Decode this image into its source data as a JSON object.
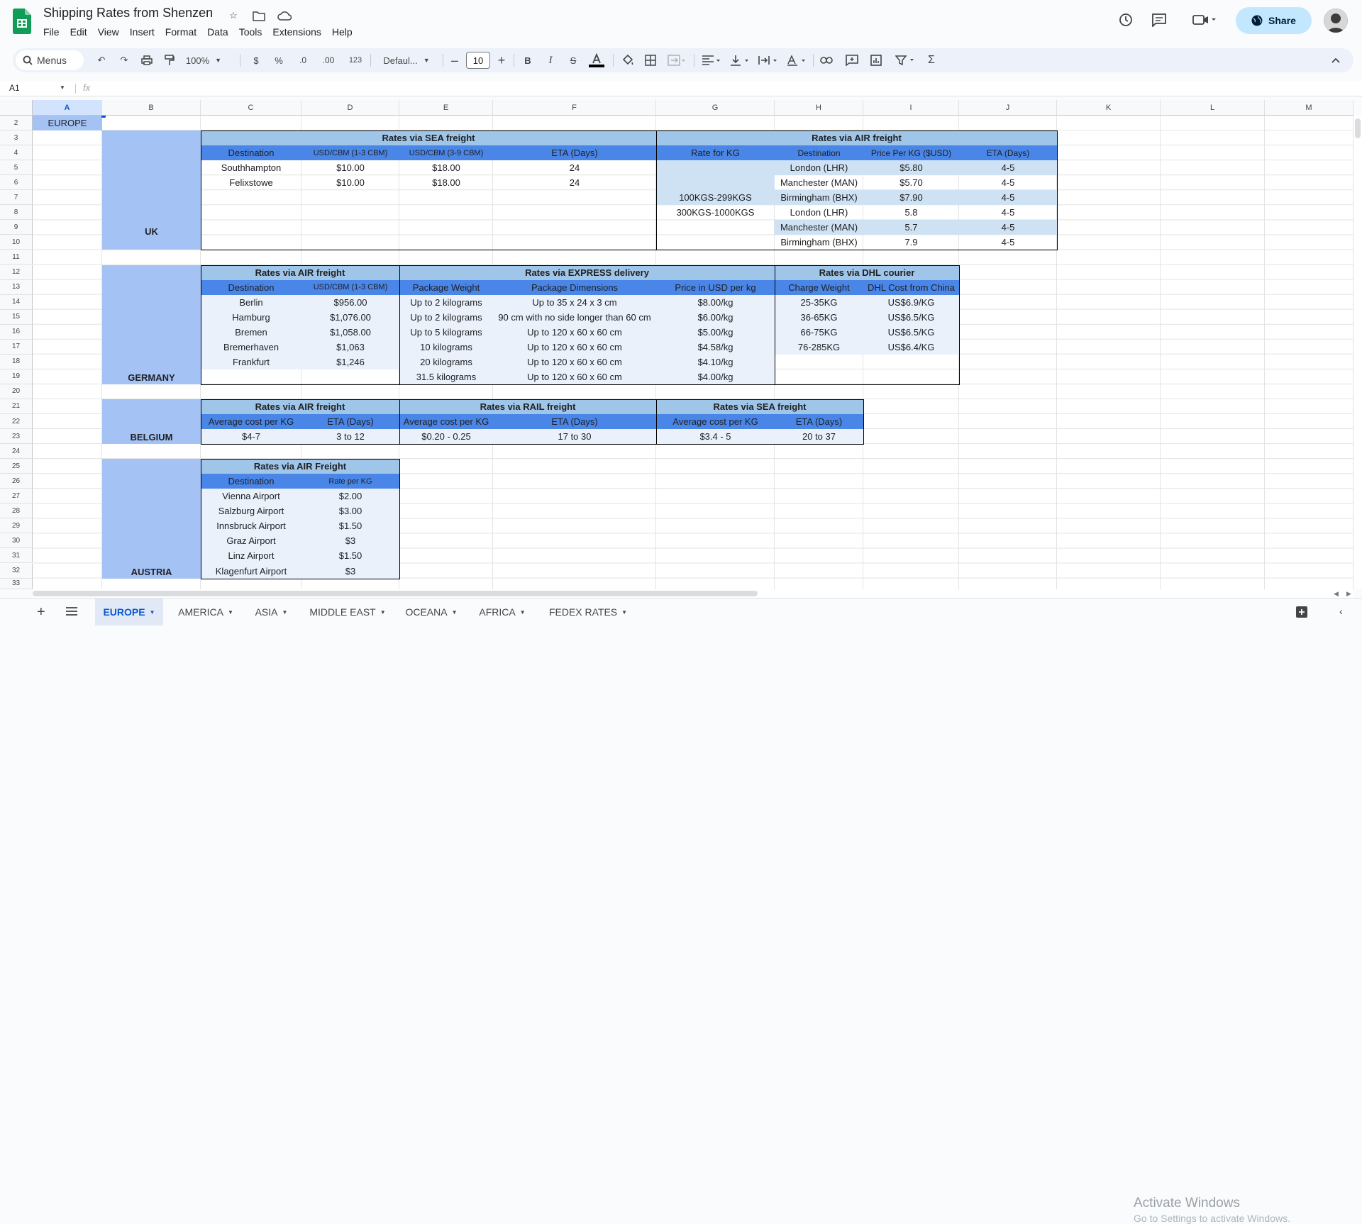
{
  "app": {
    "doc_title": "Shipping Rates from Shenzen",
    "menu": [
      "File",
      "Edit",
      "View",
      "Insert",
      "Format",
      "Data",
      "Tools",
      "Extensions",
      "Help"
    ],
    "share_label": "Share"
  },
  "toolbar": {
    "menus_label": "Menus",
    "zoom": "100%",
    "currency": "$",
    "percent": "%",
    "dec_decrease": ".0",
    "dec_increase": ".00",
    "number_format": "123",
    "font": "Defaul...",
    "font_size": "10"
  },
  "formula": {
    "cell_ref": "A1",
    "fx": "fx",
    "value": ""
  },
  "columns": [
    "A",
    "B",
    "C",
    "D",
    "E",
    "F",
    "G",
    "H",
    "I",
    "J",
    "K",
    "L",
    "M"
  ],
  "rows": [
    "2",
    "3",
    "4",
    "5",
    "6",
    "7",
    "8",
    "9",
    "10",
    "11",
    "12",
    "13",
    "14",
    "15",
    "16",
    "17",
    "18",
    "19",
    "20",
    "21",
    "22",
    "23",
    "24",
    "25",
    "26",
    "27",
    "28",
    "29",
    "30",
    "31",
    "32",
    "33"
  ],
  "sheet": {
    "region": "EUROPE",
    "uk": {
      "label": "UK",
      "sea": {
        "title": "Rates via SEA freight",
        "headers": [
          "Destination",
          "USD/CBM (1-3 CBM)",
          "USD/CBM (3-9 CBM)",
          "ETA (Days)"
        ],
        "rows": [
          [
            "Southhampton",
            "$10.00",
            "$18.00",
            "24"
          ],
          [
            "Felixstowe",
            "$10.00",
            "$18.00",
            "24"
          ]
        ]
      },
      "air": {
        "title": "Rates via AIR freight",
        "headers": [
          "Rate for KG",
          "Destination",
          "Price Per KG ($USD)",
          "ETA (Days)"
        ],
        "weight_bands": [
          "100KGS-299KGS",
          "300KGS-1000KGS"
        ],
        "rows": [
          [
            "London (LHR)",
            "$5.80",
            "4-5"
          ],
          [
            "Manchester (MAN)",
            "$5.70",
            "4-5"
          ],
          [
            "Birmingham (BHX)",
            "$7.90",
            "4-5"
          ],
          [
            "London (LHR)",
            "5.8",
            "4-5"
          ],
          [
            "Manchester (MAN)",
            "5.7",
            "4-5"
          ],
          [
            "Birmingham (BHX)",
            "7.9",
            "4-5"
          ]
        ]
      }
    },
    "germany": {
      "label": "GERMANY",
      "air": {
        "title": "Rates via AIR freight",
        "headers": [
          "Destination",
          "USD/CBM (1-3 CBM)"
        ],
        "rows": [
          [
            "Berlin",
            "$956.00"
          ],
          [
            "Hamburg",
            "$1,076.00"
          ],
          [
            "Bremen",
            "$1,058.00"
          ],
          [
            "Bremerhaven",
            "$1,063"
          ],
          [
            "Frankfurt",
            "$1,246"
          ]
        ]
      },
      "express": {
        "title": "Rates via EXPRESS delivery",
        "headers": [
          "Package Weight",
          "Package Dimensions",
          "Price in USD per kg"
        ],
        "rows": [
          [
            "Up to 2 kilograms",
            "Up to 35 x 24 x 3 cm",
            "$8.00/kg"
          ],
          [
            "Up to 2 kilograms",
            "90 cm with no side longer than 60 cm",
            "$6.00/kg"
          ],
          [
            "Up to 5 kilograms",
            "Up to 120 x 60 x 60 cm",
            "$5.00/kg"
          ],
          [
            "10 kilograms",
            "Up to 120 x 60 x 60 cm",
            "$4.58/kg"
          ],
          [
            "20 kilograms",
            "Up to 120 x 60 x 60 cm",
            "$4.10/kg"
          ],
          [
            "31.5 kilograms",
            "Up to 120 x 60 x 60 cm",
            "$4.00/kg"
          ]
        ]
      },
      "dhl": {
        "title": "Rates via DHL courier",
        "headers": [
          "Charge Weight",
          "DHL Cost from China"
        ],
        "rows": [
          [
            "25-35KG",
            "US$6.9/KG"
          ],
          [
            "36-65KG",
            "US$6.5/KG"
          ],
          [
            "66-75KG",
            "US$6.5/KG"
          ],
          [
            "76-285KG",
            "US$6.4/KG"
          ]
        ]
      }
    },
    "belgium": {
      "label": "BELGIUM",
      "air": {
        "title": "Rates via AIR freight",
        "headers": [
          "Average cost per KG",
          "ETA (Days)"
        ],
        "row": [
          "$4-7",
          "3 to 12"
        ]
      },
      "rail": {
        "title": "Rates via RAIL freight",
        "headers": [
          "Average cost per KG",
          "ETA (Days)"
        ],
        "row": [
          "$0.20 - 0.25",
          "17 to 30"
        ]
      },
      "sea": {
        "title": "Rates via SEA freight",
        "headers": [
          "Average cost per KG",
          "ETA (Days)"
        ],
        "row": [
          "$3.4 - 5",
          "20 to 37"
        ]
      }
    },
    "austria": {
      "label": "AUSTRIA",
      "air": {
        "title": "Rates via AIR Freight",
        "headers": [
          "Destination",
          "Rate per KG"
        ],
        "rows": [
          [
            "Vienna Airport",
            "$2.00"
          ],
          [
            "Salzburg Airport",
            "$3.00"
          ],
          [
            "Innsbruck Airport",
            "$1.50"
          ],
          [
            "Graz Airport",
            "$3"
          ],
          [
            "Linz Airport",
            "$1.50"
          ],
          [
            "Klagenfurt Airport",
            "$3"
          ]
        ]
      }
    }
  },
  "tabs": [
    "EUROPE",
    "AMERICA",
    "ASIA",
    "MIDDLE EAST",
    "OCEANA",
    "AFRICA",
    "FEDEX RATES"
  ],
  "active_tab": "EUROPE",
  "watermark": {
    "line1": "Activate Windows",
    "line2": "Go to Settings to activate Windows."
  },
  "colors": {
    "header_blue": "#4a86e8",
    "title_blue": "#9fc5e8",
    "region_blue": "#a4c2f4",
    "band_blue": "#cfe2f3",
    "light_row": "#eaf1fb"
  }
}
